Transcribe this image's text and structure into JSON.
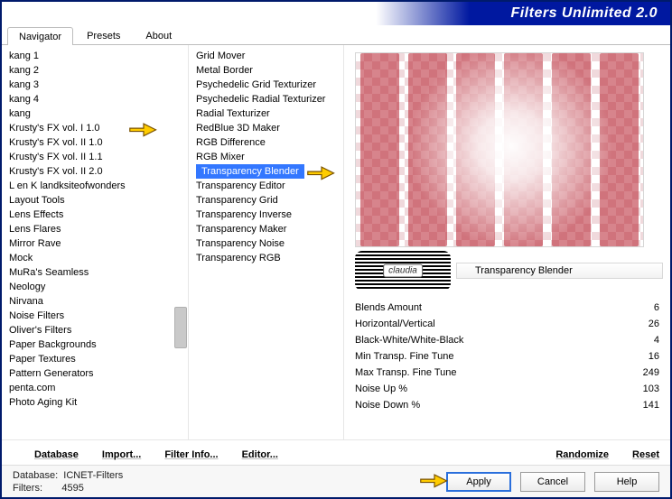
{
  "window": {
    "title": "Filters Unlimited 2.0"
  },
  "tabs": [
    {
      "label": "Navigator",
      "active": true
    },
    {
      "label": "Presets",
      "active": false
    },
    {
      "label": "About",
      "active": false
    }
  ],
  "category_list": [
    "kang 1",
    "kang 2",
    "kang 3",
    "kang 4",
    "kang",
    "Krusty's FX vol. I 1.0",
    "Krusty's FX vol. II 1.0",
    "Krusty's FX vol. II 1.1",
    "Krusty's FX vol. II 2.0",
    "L en K landksiteofwonders",
    "Layout Tools",
    "Lens Effects",
    "Lens Flares",
    "Mirror Rave",
    "Mock",
    "MuRa's Seamless",
    "Neology",
    "Nirvana",
    "Noise Filters",
    "Oliver's Filters",
    "Paper Backgrounds",
    "Paper Textures",
    "Pattern Generators",
    "penta.com",
    "Photo Aging Kit"
  ],
  "category_pointer_index": 5,
  "filter_list": [
    "Grid Mover",
    "Metal Border",
    "Psychedelic Grid Texturizer",
    "Psychedelic Radial Texturizer",
    "Radial Texturizer",
    "RedBlue 3D Maker",
    "RGB Difference",
    "RGB Mixer",
    "Transparency Blender",
    "Transparency Editor",
    "Transparency Grid",
    "Transparency Inverse",
    "Transparency Maker",
    "Transparency Noise",
    "Transparency RGB"
  ],
  "filter_selected_index": 8,
  "filter_name": "Transparency Blender",
  "params": [
    {
      "label": "Blends Amount",
      "value": 6
    },
    {
      "label": "Horizontal/Vertical",
      "value": 26
    },
    {
      "label": "Black-White/White-Black",
      "value": 4
    },
    {
      "label": "Min Transp. Fine Tune",
      "value": 16
    },
    {
      "label": "Max Transp. Fine Tune",
      "value": 249
    },
    {
      "label": "Noise Up %",
      "value": 103
    },
    {
      "label": "Noise Down %",
      "value": 141
    }
  ],
  "toolbar": {
    "database": "Database",
    "import": "Import...",
    "filter_info": "Filter Info...",
    "editor": "Editor...",
    "randomize": "Randomize",
    "reset": "Reset"
  },
  "footer": {
    "db_label": "Database:",
    "db_value": "ICNET-Filters",
    "filters_label": "Filters:",
    "filters_value": "4595",
    "apply": "Apply",
    "cancel": "Cancel",
    "help": "Help"
  },
  "logo_text": "claudia"
}
